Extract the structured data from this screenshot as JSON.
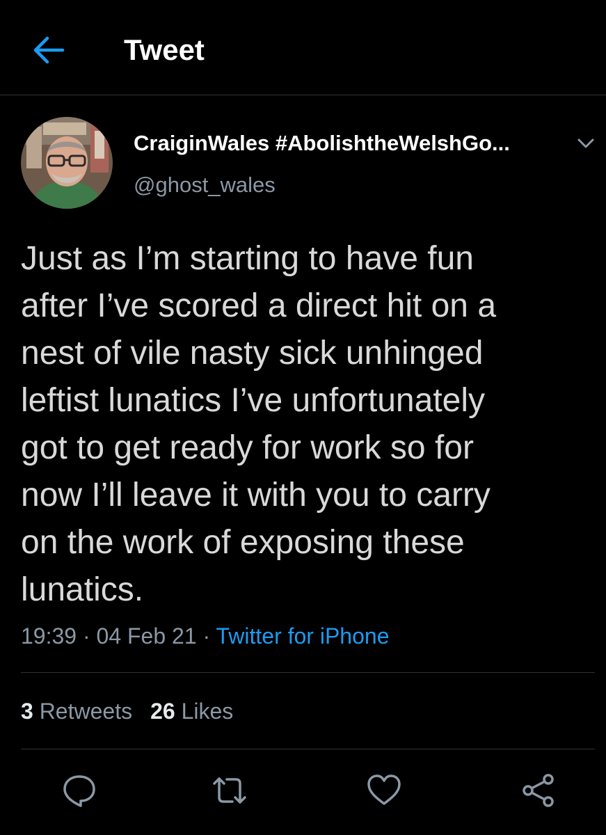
{
  "header": {
    "title": "Tweet",
    "back_icon": "arrow-left-icon"
  },
  "tweet": {
    "display_name": "CraiginWales #AbolishtheWelshGo...",
    "handle": "@ghost_wales",
    "text_lines": [
      "Just as I’m starting to have fun",
      "after I’ve scored a direct hit on a",
      "nest of vile nasty sick unhinged",
      "leftist lunatics I’ve unfortunately",
      "got to get ready for work so for",
      "now I’ll leave it with you to carry",
      "on the work of exposing these",
      "lunatics."
    ],
    "time": "19:39",
    "date": "04 Feb 21",
    "source": "Twitter for iPhone",
    "separator": "·"
  },
  "stats": {
    "retweets_count": "3",
    "retweets_label": "Retweets",
    "likes_count": "26",
    "likes_label": "Likes"
  },
  "actions": [
    "reply-icon",
    "retweet-icon",
    "like-icon",
    "share-icon"
  ],
  "colors": {
    "background": "#000000",
    "accent": "#1d9bf0",
    "secondary_text": "#8b98a5",
    "divider": "#2f3336"
  }
}
